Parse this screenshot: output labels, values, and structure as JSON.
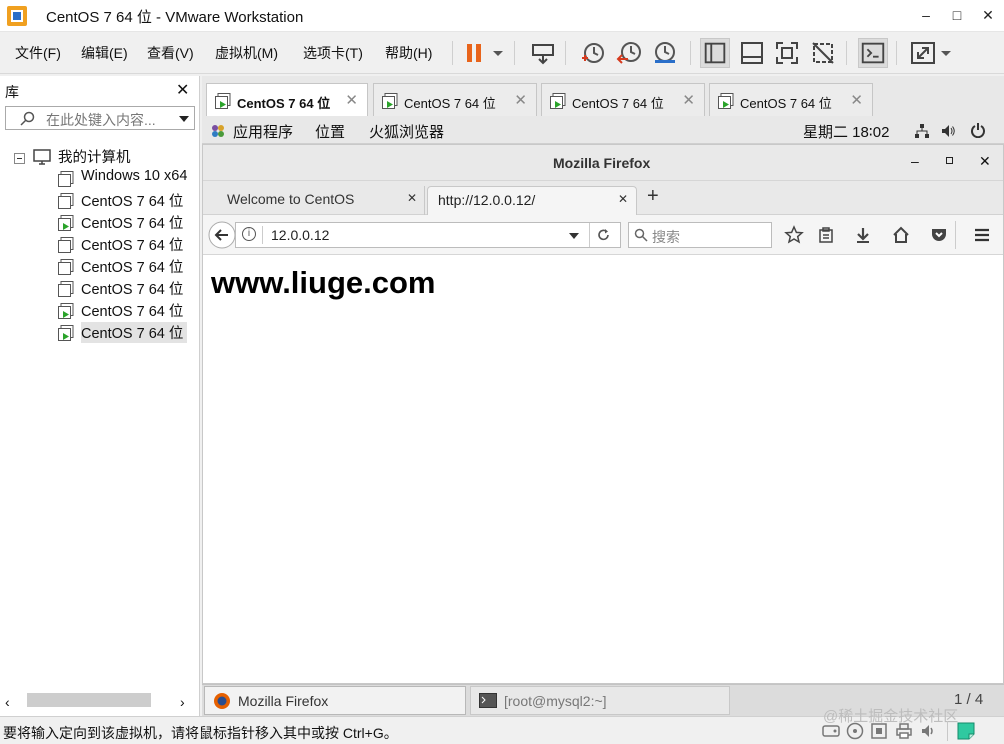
{
  "window": {
    "title": "CentOS 7 64 位 - VMware Workstation",
    "minimize": "–",
    "maximize": "□",
    "close": "✕"
  },
  "menubar": {
    "items": [
      "文件(F)",
      "编辑(E)",
      "查看(V)",
      "虚拟机(M)",
      "选项卡(T)",
      "帮助(H)"
    ]
  },
  "toolbar": {
    "icons": [
      "pause-icon",
      "dropdown-arrow-icon",
      "send-ctrl-alt-del-icon",
      "snapshot-icon",
      "revert-snapshot-icon",
      "snapshot-manager-icon",
      "show-library-icon",
      "thumbnail-bar-icon",
      "fullscreen-icon",
      "unity-icon",
      "console-view-icon",
      "stretch-icon",
      "stretch-dropdown-icon"
    ],
    "colors": {
      "pause": "#e8641b",
      "snapshot_accent": "#d63a1e"
    }
  },
  "library": {
    "title": "库",
    "close": "✕",
    "search_placeholder": "在此处键入内容...",
    "root": "我的计算机",
    "items": [
      {
        "label": "Windows 10 x64",
        "running": false
      },
      {
        "label": "CentOS 7 64 位",
        "running": false
      },
      {
        "label": "CentOS 7 64 位",
        "running": true
      },
      {
        "label": "CentOS 7 64 位",
        "running": false
      },
      {
        "label": "CentOS 7 64 位",
        "running": false
      },
      {
        "label": "CentOS 7 64 位",
        "running": false
      },
      {
        "label": "CentOS 7 64 位",
        "running": true
      },
      {
        "label": "CentOS 7 64 位",
        "running": true,
        "selected": true
      }
    ]
  },
  "vm_tabs": [
    {
      "label": "CentOS 7 64 位",
      "active": true
    },
    {
      "label": "CentOS 7 64 位",
      "active": false
    },
    {
      "label": "CentOS 7 64 位",
      "active": false
    },
    {
      "label": "CentOS 7 64 位",
      "active": false
    }
  ],
  "gnome": {
    "apps": "应用程序",
    "places": "位置",
    "browser": "火狐浏览器",
    "clock": "星期二 18∶02"
  },
  "firefox": {
    "title": "Mozilla Firefox",
    "tabs": [
      {
        "label": "Welcome to CentOS",
        "active": false
      },
      {
        "label": "http://12.0.0.12/",
        "active": true
      }
    ],
    "url": "12.0.0.12",
    "search_placeholder": "搜索",
    "content": "www.liuge.com"
  },
  "taskbar": {
    "firefox": "Mozilla Firefox",
    "terminal": "[root@mysql2:~]",
    "pager": "1 / 4"
  },
  "status": {
    "text": "要将输入定向到该虚拟机，请将鼠标指针移入其中或按 Ctrl+G。",
    "watermark": "@稀土掘金技术社区"
  }
}
